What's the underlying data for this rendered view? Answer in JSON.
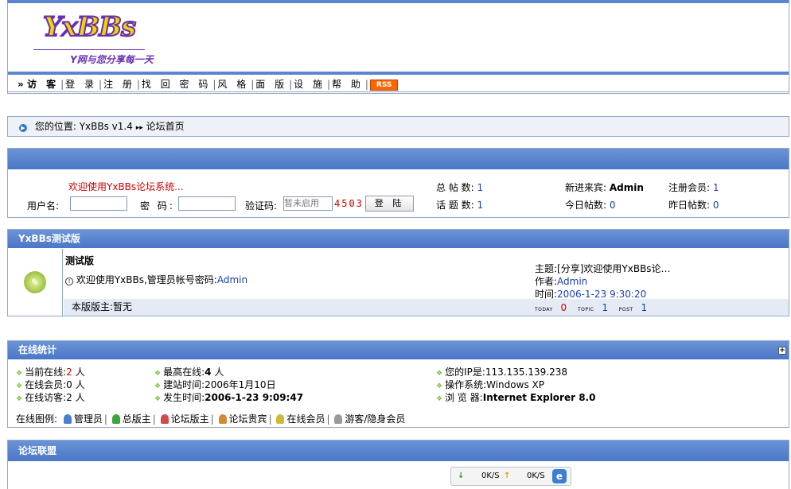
{
  "header": {
    "logo_text": "YxBBs",
    "slogan": "Y网与您分享每一天"
  },
  "nav": {
    "guest": "访 客",
    "items": [
      "登 录",
      "注 册",
      "找 回 密 码",
      "风 格",
      "面 版",
      "设 施",
      "帮 助"
    ],
    "rss": "RSS"
  },
  "breadcrumb": {
    "prefix": "您的位置:",
    "site": "YxBBs v1.4",
    "current": "论坛首页"
  },
  "login": {
    "welcome": "欢迎使用YxBBs论坛系统...",
    "username_label": "用户名:",
    "password_label": "密 码:",
    "captcha_label": "验证码:",
    "captcha_placeholder": "暂未启用",
    "captcha_code": "4503",
    "login_button": "登 陆"
  },
  "stats": {
    "total_posts_label": "总 帖 数:",
    "total_posts": "1",
    "topics_label": "话 题 数:",
    "topics": "1",
    "newest_label": "新进来宾:",
    "newest": "Admin",
    "today_label": "今日帖数:",
    "today": "0",
    "members_label": "注册会员:",
    "members": "1",
    "yesterday_label": "昨日帖数:",
    "yesterday": "0"
  },
  "board_section": {
    "title": "YxBBs测试版",
    "board_name": "测试版",
    "board_desc": "欢迎使用YxBBs,管理员帐号密码:",
    "board_desc_admin": "Admin",
    "moderator": "本版版主:暂无",
    "last_topic_label": "主题:",
    "last_topic": "[分享]欢迎使用YxBBs论…",
    "author_label": "作者:",
    "author": "Admin",
    "time_label": "时间:",
    "time": "2006-1-23 9:30:20",
    "today_label": "TODAY",
    "today": "0",
    "topic_label": "TOPIC",
    "topic": "1",
    "post_label": "POST",
    "post": "1"
  },
  "online": {
    "title": "在线统计",
    "current_label": "当前在线:",
    "current": "2",
    "members_label": "在线会员:",
    "members": "0",
    "guests_label": "在线访客:",
    "guests": "2",
    "unit": "人",
    "max_label": "最高在线:",
    "max": "4",
    "founded_label": "建站时间:",
    "founded": "2006年1月10日",
    "occurred_label": "发生时间:",
    "occurred": "2006-1-23 9:09:47",
    "ip_label": "您的IP是:",
    "ip": "113.135.139.238",
    "os_label": "操作系统:",
    "os": "Windows XP",
    "browser_label": "浏 览 器:",
    "browser": "Internet Explorer 8.0",
    "legend_label": "在线图例:",
    "legend": [
      "管理员",
      "总版主",
      "论坛版主",
      "论坛贵宾",
      "在线会员",
      "游客/隐身会员"
    ],
    "legend_colors": [
      "#4a7fd0",
      "#3aa53a",
      "#d04a4a",
      "#d08a3a",
      "#d0b83a",
      "#9a9a9a"
    ]
  },
  "alliance": {
    "title": "论坛联盟"
  },
  "speed": {
    "down": "0K/S",
    "up": "0K/S"
  }
}
